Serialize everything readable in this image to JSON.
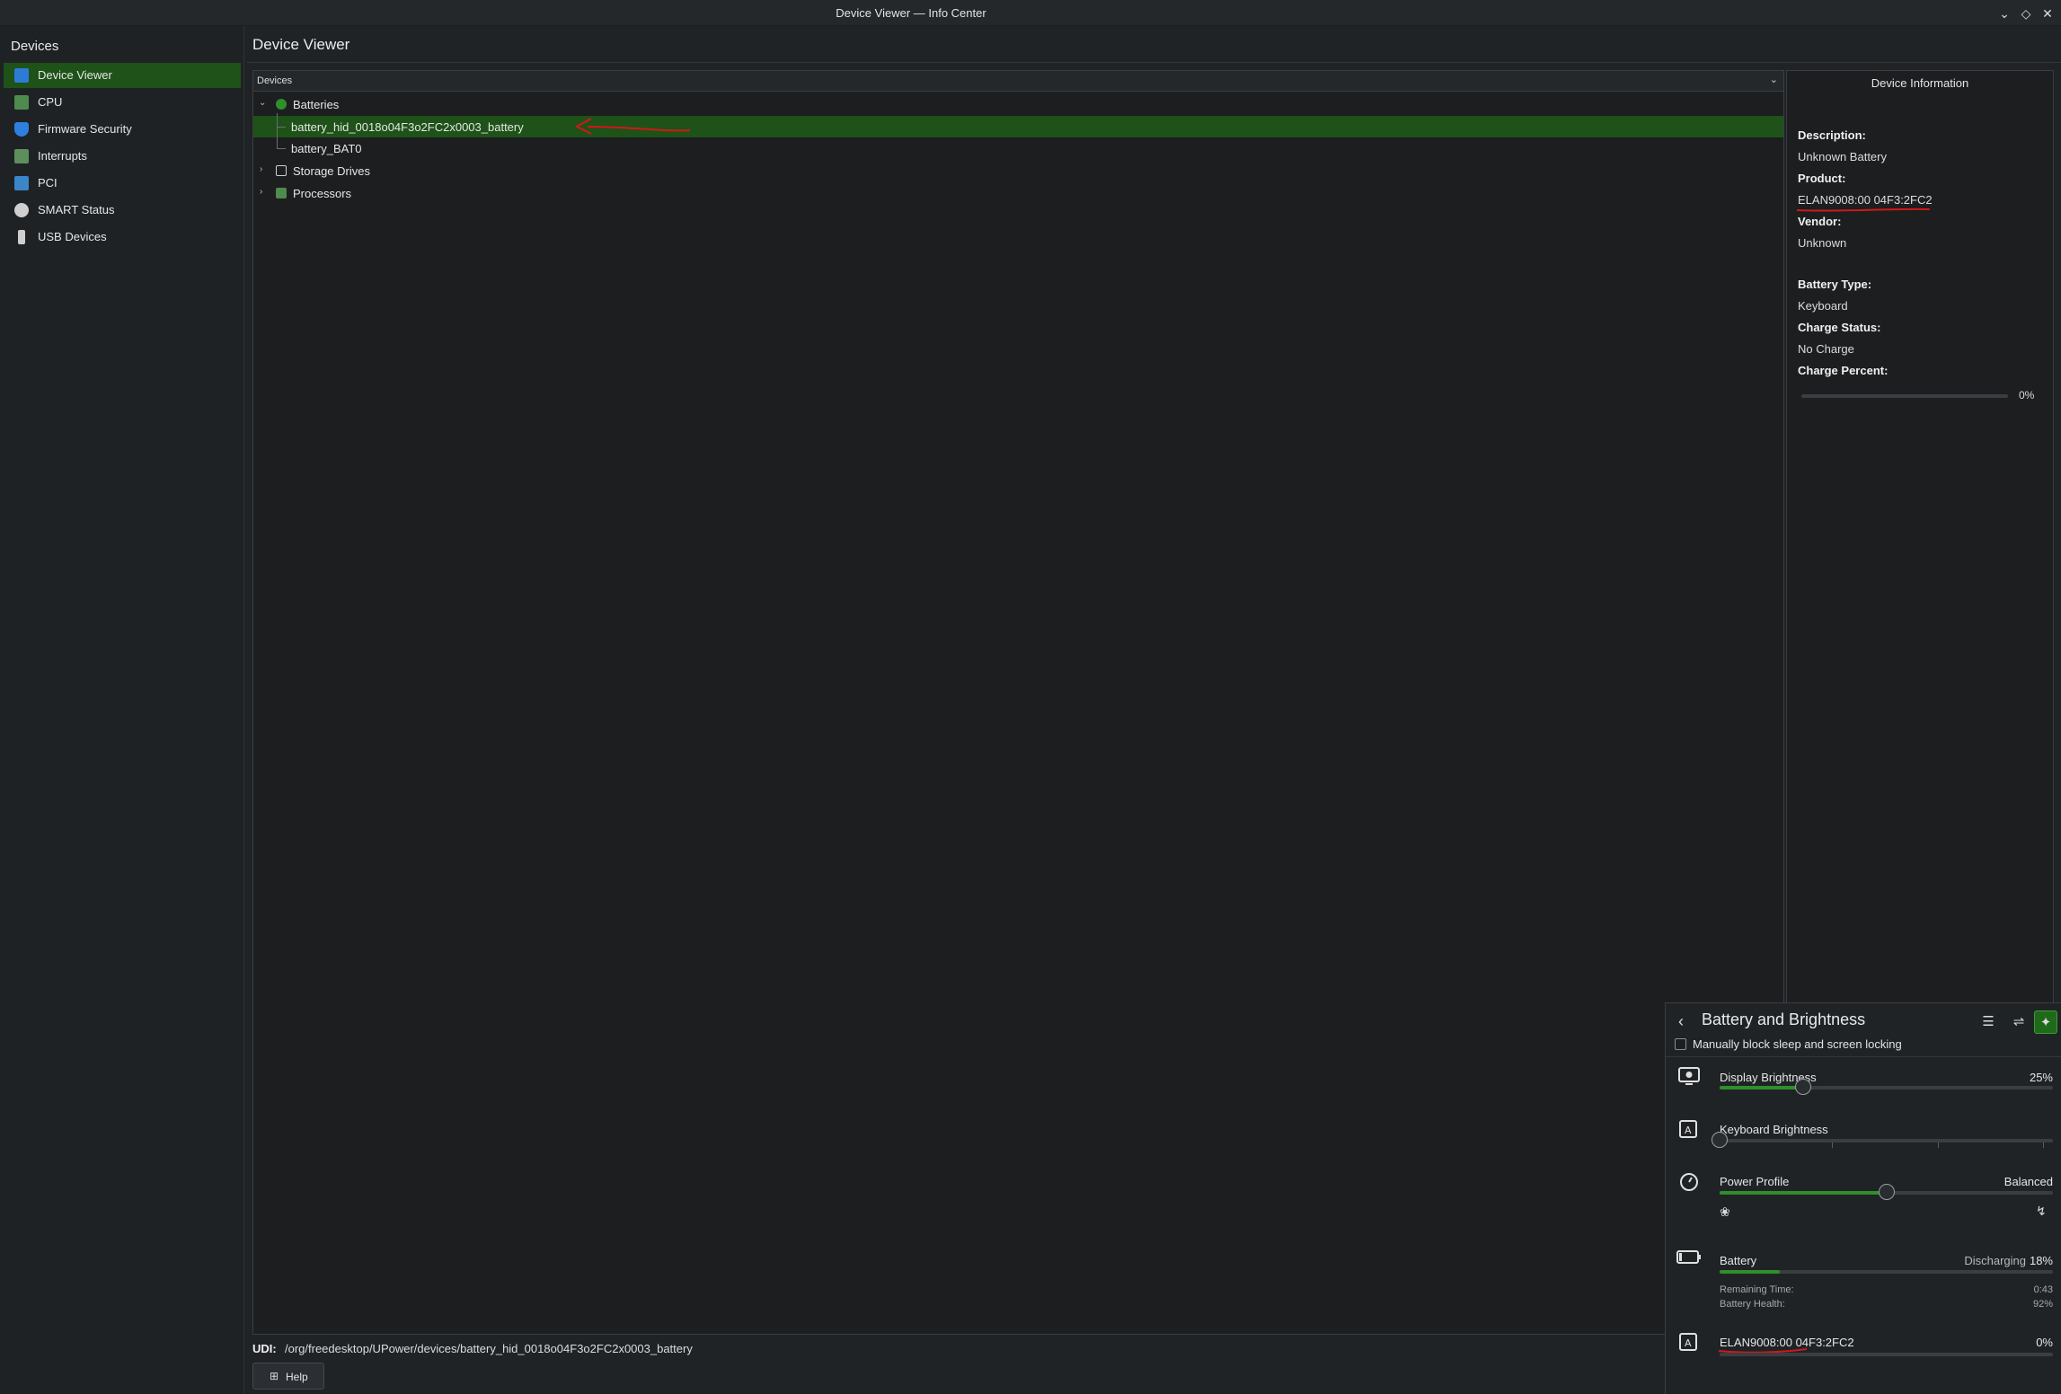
{
  "window": {
    "title": "Device Viewer — Info Center",
    "buttons": {
      "minimize": "⌄",
      "maximize": "◇",
      "close": "✕"
    }
  },
  "sidebar": {
    "title": "Devices",
    "items": [
      {
        "label": "Device Viewer",
        "icon": "info-device-icon",
        "active": true
      },
      {
        "label": "CPU",
        "icon": "cpu-icon"
      },
      {
        "label": "Firmware Security",
        "icon": "shield-icon"
      },
      {
        "label": "Interrupts",
        "icon": "interrupts-icon"
      },
      {
        "label": "PCI",
        "icon": "pci-icon"
      },
      {
        "label": "SMART Status",
        "icon": "smart-status-icon"
      },
      {
        "label": "USB Devices",
        "icon": "usb-icon"
      }
    ]
  },
  "page_title": "Device Viewer",
  "tree": {
    "header": "Devices",
    "rows": [
      {
        "label": "Batteries",
        "expanded": true
      },
      {
        "label": "battery_hid_0018o04F3o2FC2x0003_battery",
        "selected": true
      },
      {
        "label": "battery_BAT0"
      },
      {
        "label": "Storage Drives",
        "expanded": false
      },
      {
        "label": "Processors",
        "expanded": false
      }
    ]
  },
  "info": {
    "title": "Device Information",
    "fields": [
      {
        "key": "Description:",
        "value": "Unknown Battery"
      },
      {
        "key": "Product:",
        "value": "ELAN9008:00 04F3:2FC2"
      },
      {
        "key": "Vendor:",
        "value": "Unknown"
      },
      {
        "key": "Battery Type:",
        "value": "Keyboard"
      },
      {
        "key": "Charge Status:",
        "value": "No Charge"
      },
      {
        "key": "Charge Percent:",
        "value": "0%"
      }
    ],
    "charge_percent": 0
  },
  "udi": {
    "label": "UDI:",
    "value": "/org/freedesktop/UPower/devices/battery_hid_0018o04F3o2FC2x0003_battery"
  },
  "help": {
    "label": "Help"
  },
  "popup": {
    "title": "Battery and Brightness",
    "inhibit_label": "Manually block sleep and screen locking",
    "display_brightness": {
      "label": "Display Brightness",
      "value": "25%",
      "level": 0.25
    },
    "keyboard_brightness": {
      "label": "Keyboard Brightness",
      "level": 0
    },
    "power_profile": {
      "label": "Power Profile",
      "value": "Balanced",
      "level": 0.5
    },
    "battery": {
      "label": "Battery",
      "status": "Discharging",
      "percent": "18%",
      "level": 0.18,
      "remaining_label": "Remaining Time:",
      "remaining_value": "0:43",
      "health_label": "Battery Health:",
      "health_value": "92%"
    },
    "device": {
      "label": "ELAN9008:00 04F3:2FC2",
      "percent": "0%",
      "level": 0
    }
  },
  "colors": {
    "accent": "#1e5218",
    "progress": "#2f8f2b",
    "annotation": "#d01818",
    "background": "#202326"
  }
}
